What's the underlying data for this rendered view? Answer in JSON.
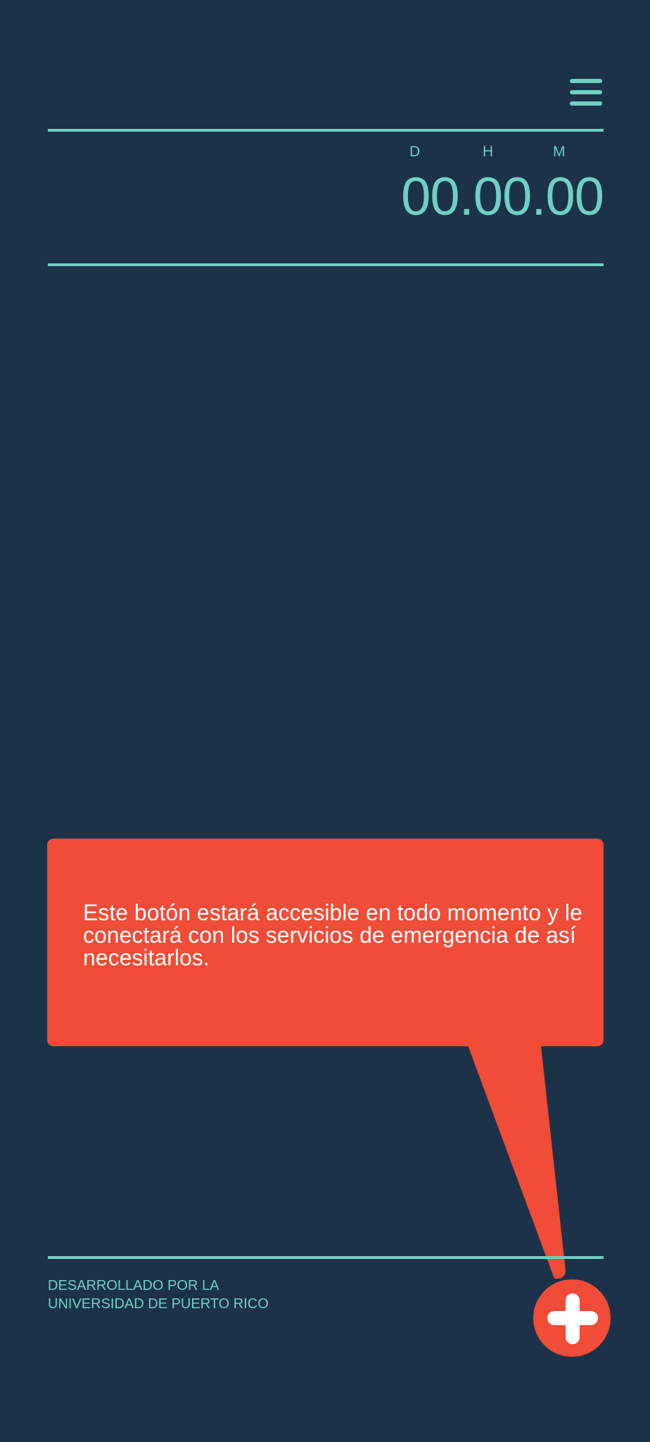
{
  "header": {
    "menu_icon": "hamburger-menu-icon"
  },
  "timer": {
    "label_days": "D",
    "label_hours": "H",
    "label_minutes": "M",
    "value": "00.00.00"
  },
  "callout": {
    "text": "Este botón estará accesible en todo momento y le conectará con los servicios de emergencia de así necesitarlos."
  },
  "footer": {
    "line1": "DESARROLLADO POR LA",
    "line2": "UNIVERSIDAD DE PUERTO RICO"
  },
  "emergency_button": {
    "icon": "plus-cross-icon"
  },
  "colors": {
    "background": "#1b3249",
    "accent": "#6fcfc3",
    "alert": "#f04c37",
    "text_on_alert": "#ffffff"
  }
}
